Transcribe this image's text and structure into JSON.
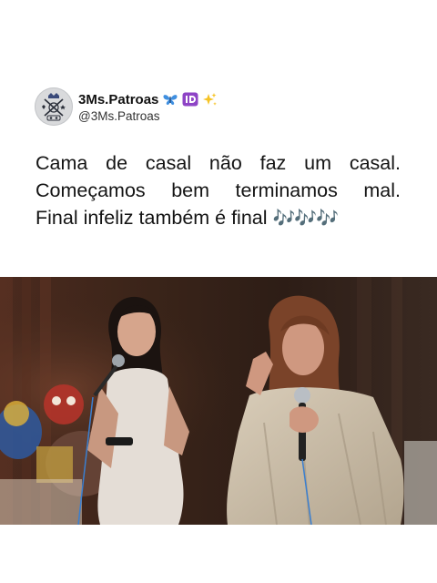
{
  "post": {
    "display_name": "3Ms.Patroas",
    "handle": "@3Ms.Patroas",
    "badges": [
      "butterfly-icon",
      "id-badge-icon",
      "sparkles-icon"
    ],
    "text_lines": [
      "Cama de casal não faz um casal.",
      "Começamos bem terminamos mal.",
      "Final infeliz também é final"
    ],
    "text_suffix": "🎶🎶🎶",
    "colors": {
      "text": "#141414",
      "notes": "#9b3fc9",
      "id_badge": "#8e44c6"
    }
  },
  "photo": {
    "content": "two-women-singing-with-microphones"
  }
}
